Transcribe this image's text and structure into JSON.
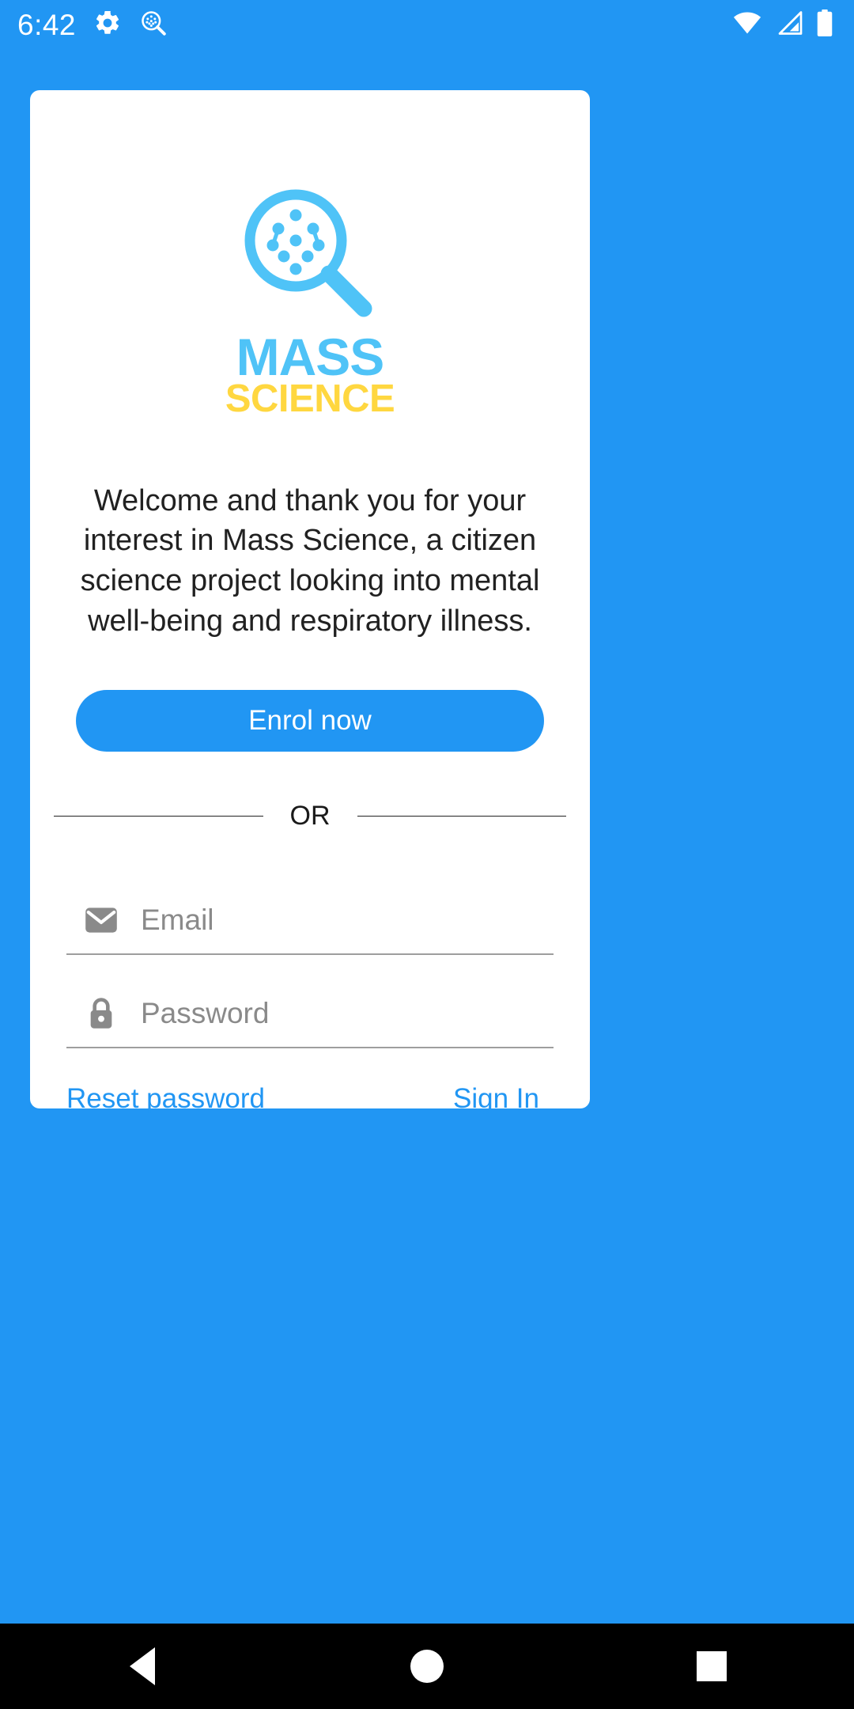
{
  "status_bar": {
    "time": "6:42",
    "icons_left": [
      "gear-icon",
      "mass-science-app-icon"
    ],
    "icons_right": [
      "wifi-icon",
      "cellular-signal-icon",
      "battery-icon"
    ],
    "background_color": "#2196F3",
    "foreground_color": "#FFFFFF"
  },
  "logo": {
    "mark": "magnifying-glass-with-dot-network",
    "mark_color": "#4FC3F7",
    "title_primary": "MASS",
    "title_primary_color": "#4FC3F7",
    "title_secondary": "SCIENCE",
    "title_secondary_color": "#FFD740"
  },
  "content": {
    "welcome_text": "Welcome and thank you for your interest in Mass Science, a citizen science project looking into mental well-being  and respiratory illness."
  },
  "actions": {
    "enrol_label": "Enrol now",
    "enrol_color": "#2196F3",
    "divider_label": "OR"
  },
  "form": {
    "email": {
      "placeholder": "Email",
      "value": "",
      "icon": "envelope-icon"
    },
    "password": {
      "placeholder": "Password",
      "value": "",
      "icon": "lock-icon"
    },
    "reset_password_label": "Reset password",
    "sign_in_label": "Sign In",
    "link_color": "#2196F3"
  },
  "nav_bar": {
    "back_label": "Back",
    "home_label": "Home",
    "recents_label": "Recents",
    "background_color": "#000000"
  }
}
